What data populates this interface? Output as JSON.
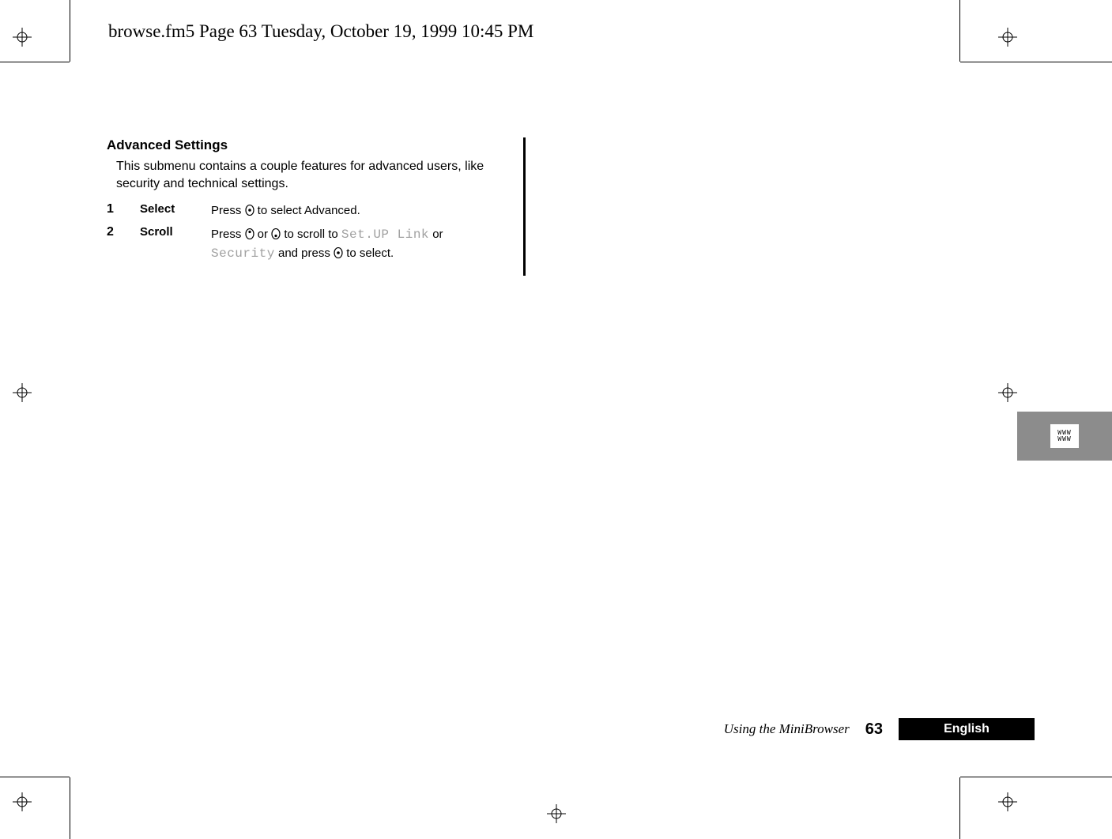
{
  "running_head": "browse.fm5  Page 63  Tuesday, October 19, 1999  10:45 PM",
  "section": {
    "title": "Advanced Settings",
    "intro": "This submenu contains a couple features for advanced users, like security and technical settings."
  },
  "steps": [
    {
      "num": "1",
      "label": "Select",
      "desc_prefix": "Press ",
      "desc_suffix": " to select Advanced."
    },
    {
      "num": "2",
      "label": "Scroll",
      "p1": "Press ",
      "p2": " or ",
      "p3": " to scroll to ",
      "lcd1": "Set.UP Link",
      "p4": " or ",
      "lcd2": "Security",
      "p5": " and press ",
      "p6": " to select."
    }
  ],
  "side_tab": {
    "line1": "WWW",
    "line2": "WWW"
  },
  "footer": {
    "section_title": "Using the MiniBrowser",
    "page": "63",
    "language": "English"
  }
}
